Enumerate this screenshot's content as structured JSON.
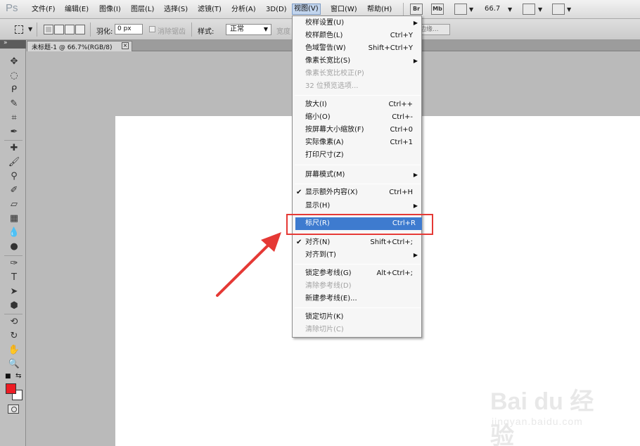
{
  "menubar": {
    "app_logo": "Ps",
    "items": [
      "文件(F)",
      "编辑(E)",
      "图像(I)",
      "图层(L)",
      "选择(S)",
      "滤镜(T)",
      "分析(A)",
      "3D(D)",
      "视图(V)",
      "窗口(W)",
      "帮助(H)"
    ],
    "active_item": "视图(V)",
    "bridge_label": "Br",
    "minibridge_label": "Mb",
    "zoom_value": "66.7"
  },
  "options": {
    "feather_label": "羽化:",
    "feather_value": "0 px",
    "antialias_label": "消除锯齿",
    "style_label": "样式:",
    "style_value": "正常",
    "width_label": "宽度",
    "refine_edge_label": "边缘..."
  },
  "document": {
    "tab_title": "未标题-1 @ 66.7%(RGB/8)",
    "tab_close": "×"
  },
  "tools": {
    "fg_color": "#ed1c24",
    "bg_color": "#ffffff",
    "icons": [
      "move-icon",
      "marquee-icon",
      "lasso-icon",
      "quick-select-icon",
      "crop-icon",
      "eyedropper-icon",
      "healing-brush-icon",
      "brush-icon",
      "clone-stamp-icon",
      "history-brush-icon",
      "eraser-icon",
      "gradient-icon",
      "blur-icon",
      "dodge-icon",
      "pen-icon",
      "type-icon",
      "path-select-icon",
      "shape-icon",
      "3d-rotate-icon",
      "3d-orbit-icon",
      "hand-icon",
      "zoom-icon"
    ]
  },
  "view_menu": {
    "items": [
      {
        "label": "校样设置(U)",
        "shortcut": "",
        "submenu": true
      },
      {
        "label": "校样颜色(L)",
        "shortcut": "Ctrl+Y"
      },
      {
        "label": "色域警告(W)",
        "shortcut": "Shift+Ctrl+Y"
      },
      {
        "label": "像素长宽比(S)",
        "shortcut": "",
        "submenu": true
      },
      {
        "label": "像素长宽比校正(P)",
        "shortcut": "",
        "disabled": true
      },
      {
        "label": "32 位预览选项...",
        "shortcut": "",
        "disabled": true
      },
      {
        "label": "放大(I)",
        "shortcut": "Ctrl++"
      },
      {
        "label": "缩小(O)",
        "shortcut": "Ctrl+-"
      },
      {
        "label": "按屏幕大小缩放(F)",
        "shortcut": "Ctrl+0"
      },
      {
        "label": "实际像素(A)",
        "shortcut": "Ctrl+1"
      },
      {
        "label": "打印尺寸(Z)",
        "shortcut": ""
      },
      {
        "label": "屏幕模式(M)",
        "shortcut": "",
        "submenu": true
      },
      {
        "label": "显示额外内容(X)",
        "shortcut": "Ctrl+H",
        "checked": true
      },
      {
        "label": "显示(H)",
        "shortcut": "",
        "submenu": true
      },
      {
        "label": "标尺(R)",
        "shortcut": "Ctrl+R",
        "highlighted": true
      },
      {
        "label": "对齐(N)",
        "shortcut": "Shift+Ctrl+;",
        "checked": true
      },
      {
        "label": "对齐到(T)",
        "shortcut": "",
        "submenu": true
      },
      {
        "label": "锁定参考线(G)",
        "shortcut": "Alt+Ctrl+;"
      },
      {
        "label": "清除参考线(D)",
        "shortcut": "",
        "disabled": true
      },
      {
        "label": "新建参考线(E)...",
        "shortcut": ""
      },
      {
        "label": "锁定切片(K)",
        "shortcut": ""
      },
      {
        "label": "清除切片(C)",
        "shortcut": "",
        "disabled": true
      }
    ]
  },
  "annotation": {
    "highlight_color": "#e53935"
  },
  "watermark": {
    "logo": "Bai du 经验",
    "url": "jingyan.baidu.com"
  }
}
